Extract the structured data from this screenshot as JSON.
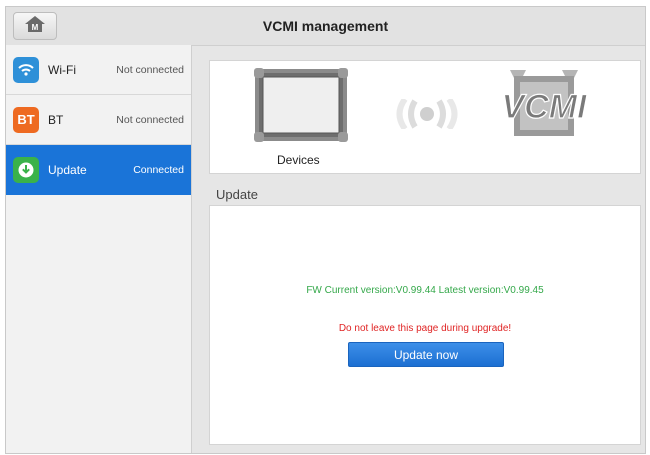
{
  "header": {
    "title": "VCMI management",
    "home_icon": "home-icon"
  },
  "sidebar": {
    "items": [
      {
        "icon": "wifi-icon",
        "label": "Wi-Fi",
        "status": "Not connected",
        "active": false
      },
      {
        "icon": "bt-icon",
        "icon_text": "BT",
        "label": "BT",
        "status": "Not connected",
        "active": false
      },
      {
        "icon": "download-icon",
        "label": "Update",
        "status": "Connected",
        "active": true
      }
    ]
  },
  "devices": {
    "label": "Devices",
    "logo_text": "VCMI"
  },
  "update": {
    "section_label": "Update",
    "fw_text": "FW Current version:V0.99.44 Latest version:V0.99.45",
    "warning": "Do not leave this page during upgrade!",
    "button_label": "Update now"
  },
  "colors": {
    "accent": "#1a74d8",
    "success": "#34a84a",
    "warning": "#e02424",
    "wifi_icon_bg": "#2e90d8",
    "bt_icon_bg": "#ee6a21",
    "update_icon_bg": "#3ab24a"
  }
}
